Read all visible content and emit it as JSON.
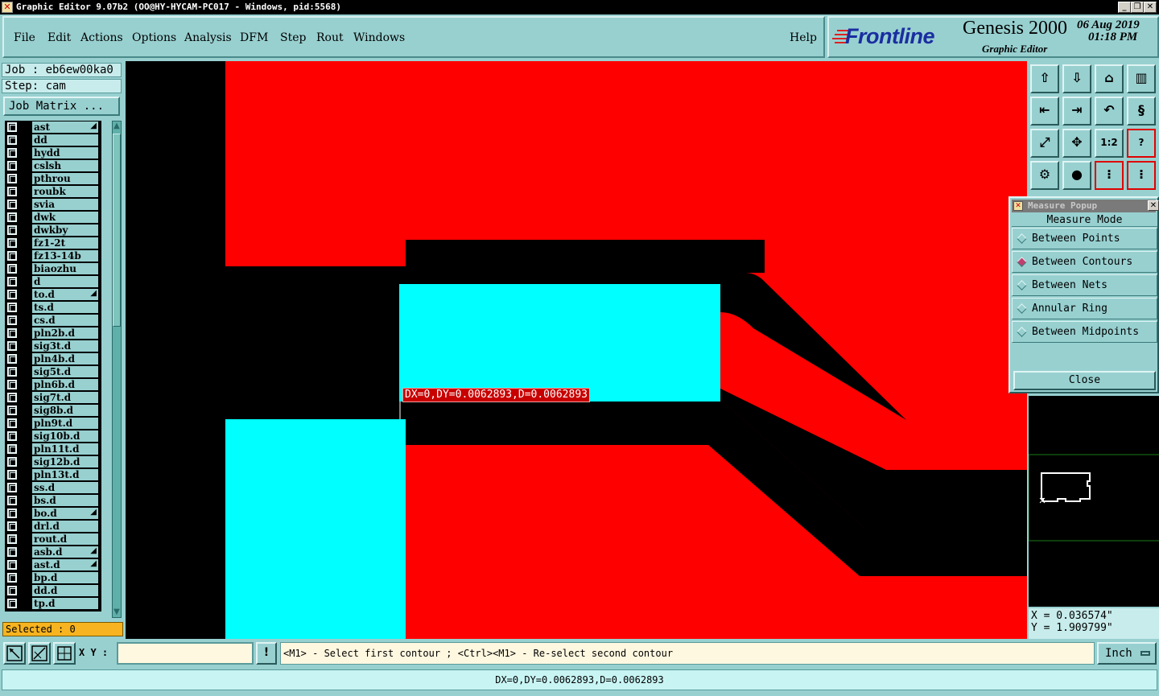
{
  "window": {
    "title": "Graphic Editor 9.07b2 (OO@HY-HYCAM-PC017 - Windows, pid:5568)",
    "controls": [
      "_",
      "❐",
      "✕"
    ]
  },
  "menu": [
    {
      "label": "File"
    },
    {
      "label": "Edit"
    },
    {
      "label": "Actions"
    },
    {
      "label": "Options"
    },
    {
      "label": "Analysis"
    },
    {
      "label": "DFM"
    },
    {
      "label": "Step"
    },
    {
      "label": "Rout"
    },
    {
      "label": "Windows"
    },
    {
      "label": "Help"
    }
  ],
  "brand": {
    "logo": "Frontline",
    "product": "Genesis 2000",
    "subtitle": "Graphic Editor",
    "date": "06 Aug 2019",
    "time": "01:18 PM"
  },
  "job": {
    "job_label": "Job : eb6ew00ka0",
    "step_label": "Step: cam",
    "matrix_button": "Job Matrix ..."
  },
  "layers": [
    {
      "name": "ast",
      "marked": true
    },
    {
      "name": "dd"
    },
    {
      "name": "hydd"
    },
    {
      "name": "cslsh"
    },
    {
      "name": "pthrou"
    },
    {
      "name": "roubk"
    },
    {
      "name": "svia"
    },
    {
      "name": "dwk"
    },
    {
      "name": "dwkby"
    },
    {
      "name": "fz1-2t"
    },
    {
      "name": "fz13-14b"
    },
    {
      "name": "biaozhu"
    },
    {
      "name": "d"
    },
    {
      "name": "to.d",
      "marked": true
    },
    {
      "name": "ts.d"
    },
    {
      "name": "cs.d"
    },
    {
      "name": "pln2b.d"
    },
    {
      "name": "sig3t.d"
    },
    {
      "name": "pln4b.d"
    },
    {
      "name": "sig5t.d"
    },
    {
      "name": "pln6b.d"
    },
    {
      "name": "sig7t.d"
    },
    {
      "name": "sig8b.d"
    },
    {
      "name": "pln9t.d"
    },
    {
      "name": "sig10b.d"
    },
    {
      "name": "pln11t.d"
    },
    {
      "name": "sig12b.d"
    },
    {
      "name": "pln13t.d"
    },
    {
      "name": "ss.d"
    },
    {
      "name": "bs.d"
    },
    {
      "name": "bo.d",
      "marked": true
    },
    {
      "name": "drl.d"
    },
    {
      "name": "rout.d"
    },
    {
      "name": "asb.d",
      "marked": true
    },
    {
      "name": "ast.d",
      "marked": true
    },
    {
      "name": "bp.d"
    },
    {
      "name": "dd.d"
    },
    {
      "name": "tp.d"
    }
  ],
  "selected_label": "Selected : 0",
  "canvas": {
    "measure_label": "DX=0,DY=0.0062893,D=0.0062893",
    "colors": {
      "background": "#000000",
      "layer_red": "#ff0000",
      "layer_cyan": "#00ffff"
    }
  },
  "toolbar": [
    {
      "icon": "save-up-icon"
    },
    {
      "icon": "save-down-icon"
    },
    {
      "icon": "home-icon"
    },
    {
      "icon": "window-split-icon"
    },
    {
      "icon": "pan-left-icon"
    },
    {
      "icon": "pan-right-icon"
    },
    {
      "icon": "zoom-back-icon"
    },
    {
      "icon": "snake-icon"
    },
    {
      "icon": "fit-all-icon"
    },
    {
      "icon": "zoom-fit-icon"
    },
    {
      "icon": "scale-icon",
      "text": "1:2"
    },
    {
      "icon": "help-icon",
      "text": "?"
    },
    {
      "icon": "tools-icon"
    },
    {
      "icon": "net-icon"
    },
    {
      "icon": "layers-red-icon"
    },
    {
      "icon": "layers-icon"
    }
  ],
  "measure_popup": {
    "title": "Measure Popup",
    "heading": "Measure Mode",
    "options": [
      {
        "label": "Between Points",
        "selected": false
      },
      {
        "label": "Between Contours",
        "selected": true
      },
      {
        "label": "Between Nets",
        "selected": false
      },
      {
        "label": "Annular Ring",
        "selected": false
      },
      {
        "label": "Between Midpoints",
        "selected": false
      }
    ],
    "close_label": "Close"
  },
  "coords": {
    "x": "X = 0.036574\"",
    "y": "Y = 1.909799\""
  },
  "bottom": {
    "xy_label": "X Y :",
    "xy_value": "",
    "excl": "!",
    "prompt": "<M1> - Select first contour ; <Ctrl><M1> - Re-select second contour",
    "units": "Inch"
  },
  "status": "DX=0,DY=0.0062893,D=0.0062893"
}
